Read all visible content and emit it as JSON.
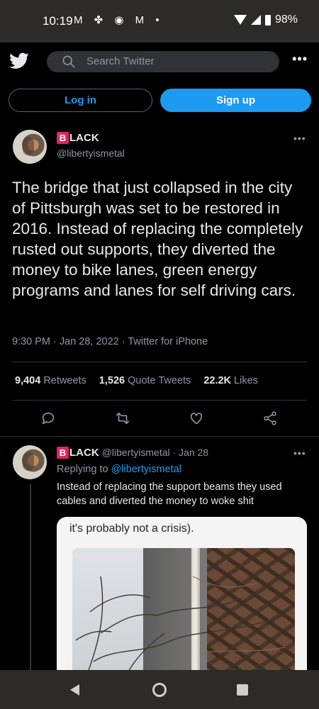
{
  "status_bar": {
    "time": "10:19",
    "notification_icons": "M ✤ ◉ M •",
    "battery": "98%"
  },
  "topbar": {
    "logo": "twitter-bird-icon",
    "search_placeholder": "Search Twitter",
    "more_label": "•••"
  },
  "auth": {
    "login_label": "Log in",
    "signup_label": "Sign up"
  },
  "tweet": {
    "badge": "B",
    "name_rest": "LACK",
    "handle": "@libertyismetal",
    "more_label": "•••",
    "text": "The bridge that just collapsed in the city of Pittsburgh was set to be restored in 2016. Instead of replacing the completely rusted out supports, they diverted the money to bike lanes, green energy programs and lanes for self driving cars.",
    "meta": "9:30 PM · Jan 28, 2022 · Twitter for iPhone",
    "retweets_count": "9,404",
    "retweets_label": "Retweets",
    "quotes_count": "1,526",
    "quotes_label": "Quote Tweets",
    "likes_count": "22.2K",
    "likes_label": "Likes"
  },
  "reply": {
    "badge": "B",
    "name_rest": "LACK",
    "handle_date": "@libertyismetal · Jan 28",
    "more_label": "•••",
    "replying_prefix": "Replying to",
    "replying_handle": "@libertyismetal",
    "text": "Instead of replacing the support beams they used cables and diverted the money to woke shit",
    "media_caption": "it's probably not a crisis)."
  },
  "colors": {
    "accent": "#1d9bf0",
    "badge": "#e0245e",
    "background": "#000000",
    "system_bar": "#2c2b27"
  }
}
